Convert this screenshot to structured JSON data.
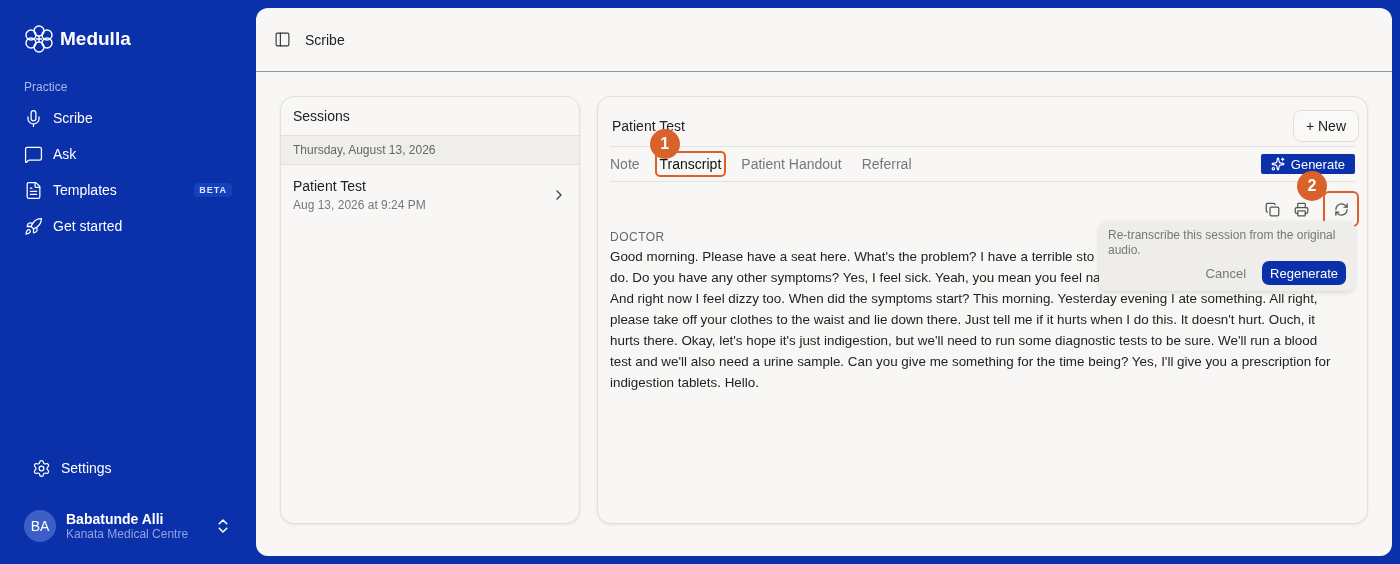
{
  "sidebar": {
    "brand": "Medulla",
    "section": "Practice",
    "items": [
      {
        "label": "Scribe"
      },
      {
        "label": "Ask"
      },
      {
        "label": "Templates",
        "badge": "BETA"
      },
      {
        "label": "Get started"
      }
    ],
    "settings": "Settings",
    "user": {
      "initials": "BA",
      "name": "Babatunde Alli",
      "org": "Kanata Medical Centre"
    }
  },
  "header": {
    "title": "Scribe"
  },
  "sessions": {
    "title": "Sessions",
    "groups": [
      {
        "date": "Thursday, August 13, 2026",
        "items": [
          {
            "name": "Patient Test",
            "time": "Aug 13, 2026 at 9:24 PM"
          }
        ]
      }
    ]
  },
  "detail": {
    "title": "Patient Test",
    "new_button": "+ New",
    "tabs": [
      {
        "label": "Note",
        "selected": false
      },
      {
        "label": "Transcript",
        "selected": true,
        "callout": "1"
      },
      {
        "label": "Patient Handout",
        "selected": false
      },
      {
        "label": "Referral",
        "selected": false
      }
    ],
    "generate_button": "Generate",
    "regenerate_callout": "2",
    "speaker": "DOCTOR",
    "transcript_lines": [
      "Good morning. Please have a seat here. What's the problem? I have a terrible sto",
      "do. Do you have any other symptoms? Yes, I feel sick. Yeah, you mean you feel na",
      "And right now I feel dizzy too. When did the symptoms start? This morning. Yesterday evening I ate something. All right,",
      "please take off your clothes to the waist and lie down there. Just tell me if it hurts when I do this. It doesn't hurt. Ouch, it",
      "hurts there. Okay, let's hope it's just indigestion, but we'll need to run some diagnostic tests to be sure. We'll run a blood",
      "test and we'll also need a urine sample. Can you give me something for the time being? Yes, I'll give you a prescription for",
      "indigestion tablets. Hello."
    ],
    "popover": {
      "text": "Re-transcribe this session from the original audio.",
      "cancel": "Cancel",
      "confirm": "Regenerate"
    }
  }
}
